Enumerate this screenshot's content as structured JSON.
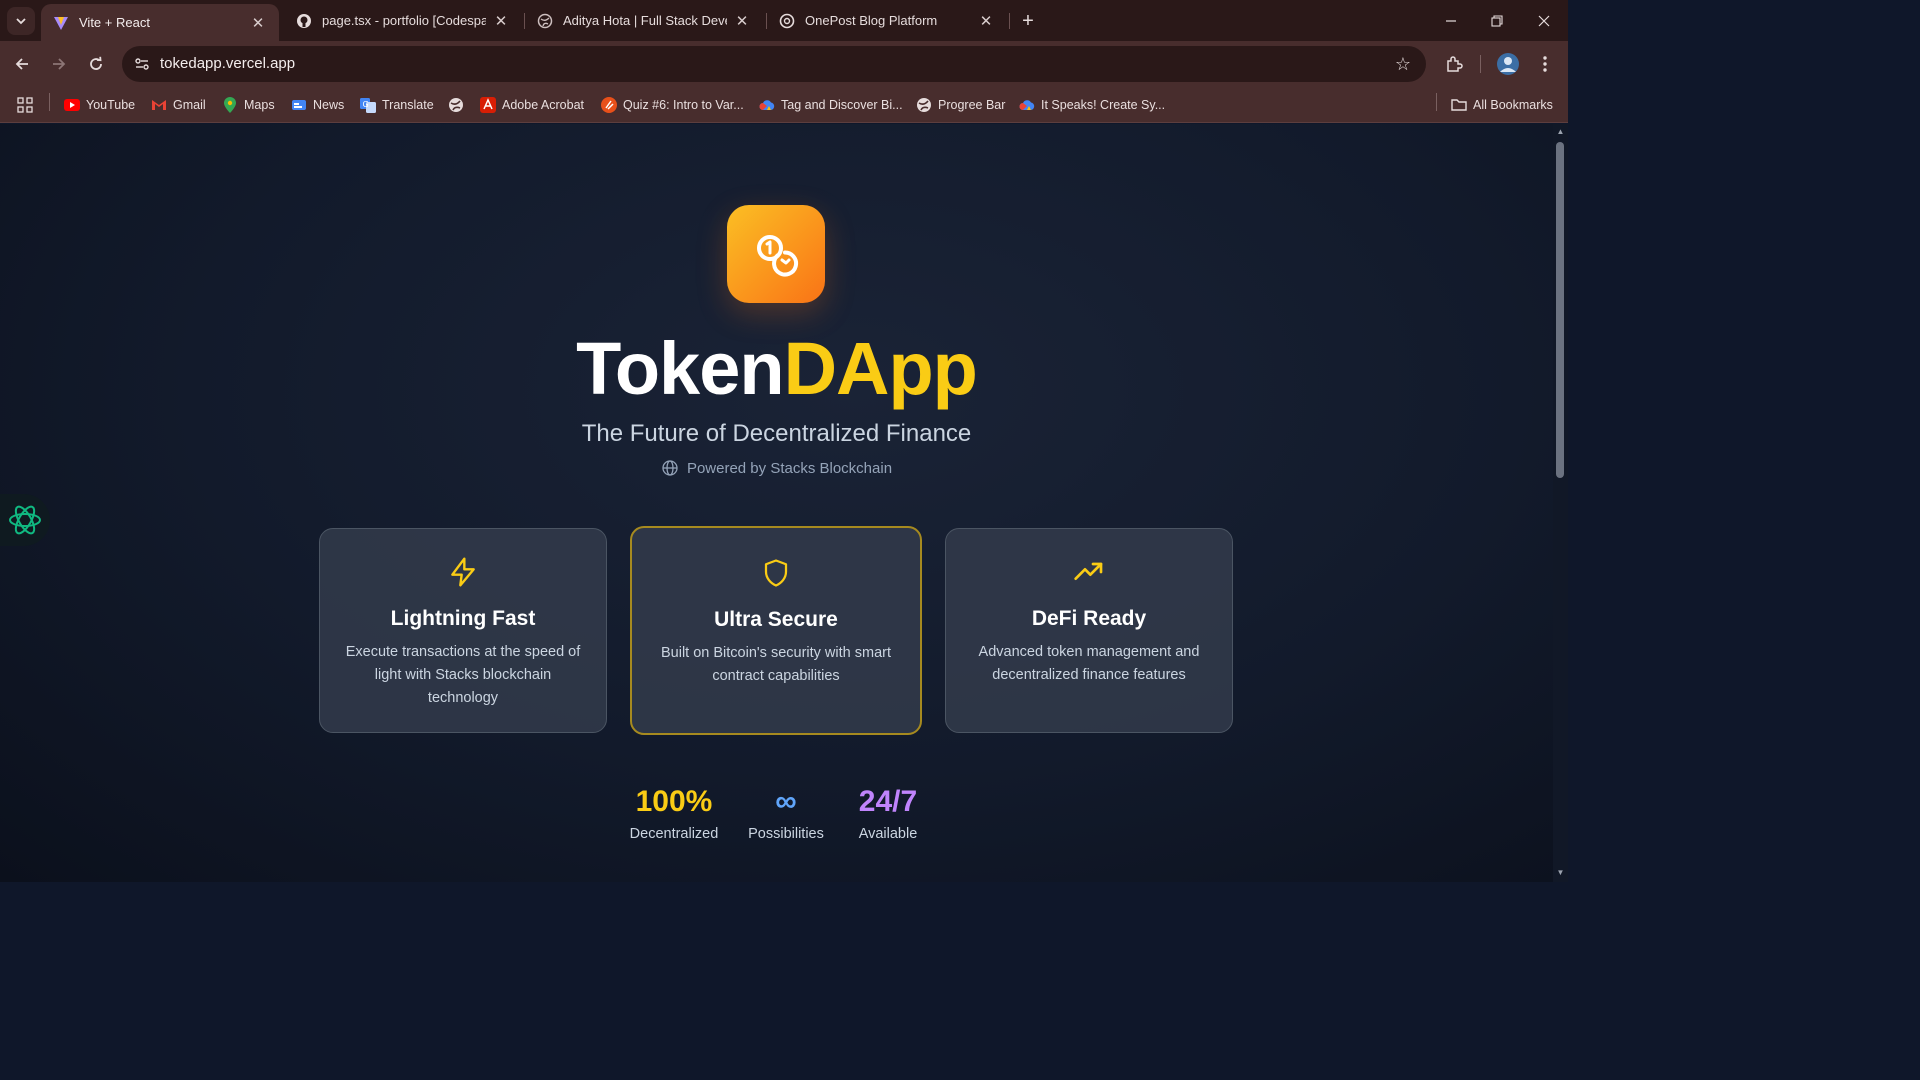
{
  "browser": {
    "tabs": [
      {
        "title": "Vite + React",
        "active": true
      },
      {
        "title": "page.tsx - portfolio [Codespace",
        "active": false
      },
      {
        "title": "Aditya Hota | Full Stack Develop",
        "active": false
      },
      {
        "title": "OnePost Blog Platform",
        "active": false
      }
    ],
    "new_tab_label": "+",
    "url": "tokedapp.vercel.app",
    "bookmarks": [
      {
        "label": "YouTube",
        "icon": "youtube-icon"
      },
      {
        "label": "Gmail",
        "icon": "gmail-icon"
      },
      {
        "label": "Maps",
        "icon": "maps-icon"
      },
      {
        "label": "News",
        "icon": "news-icon"
      },
      {
        "label": "Translate",
        "icon": "translate-icon"
      },
      {
        "label": "",
        "icon": "globe-icon"
      },
      {
        "label": "Adobe Acrobat",
        "icon": "acrobat-icon"
      },
      {
        "label": "Quiz #6: Intro to Var...",
        "icon": "quiz-icon"
      },
      {
        "label": "Tag and Discover Bi...",
        "icon": "cloud-icon"
      },
      {
        "label": "Progree Bar",
        "icon": "globe-icon"
      },
      {
        "label": "It Speaks! Create Sy...",
        "icon": "cloud-icon"
      }
    ],
    "all_bookmarks_label": "All Bookmarks"
  },
  "hero": {
    "brand_part1": "Token",
    "brand_part2": "DApp",
    "tagline": "The Future of Decentralized Finance",
    "powered_by": "Powered by Stacks Blockchain"
  },
  "features": [
    {
      "icon": "lightning-icon",
      "title": "Lightning Fast",
      "desc": "Execute transactions at the speed of light with Stacks blockchain technology"
    },
    {
      "icon": "shield-icon",
      "title": "Ultra Secure",
      "desc": "Built on Bitcoin's security with smart contract capabilities"
    },
    {
      "icon": "trending-up-icon",
      "title": "DeFi Ready",
      "desc": "Advanced token management and decentralized finance features"
    }
  ],
  "stats": [
    {
      "value": "100%",
      "label": "Decentralized",
      "color": "#facc15"
    },
    {
      "value": "∞",
      "label": "Possibilities",
      "color": "#60a5fa"
    },
    {
      "value": "24/7",
      "label": "Available",
      "color": "#c084fc"
    }
  ],
  "colors": {
    "accent": "#facc15",
    "logo_gradient_start": "#fbbf24",
    "logo_gradient_end": "#f97316",
    "chrome": "#482d2d"
  }
}
